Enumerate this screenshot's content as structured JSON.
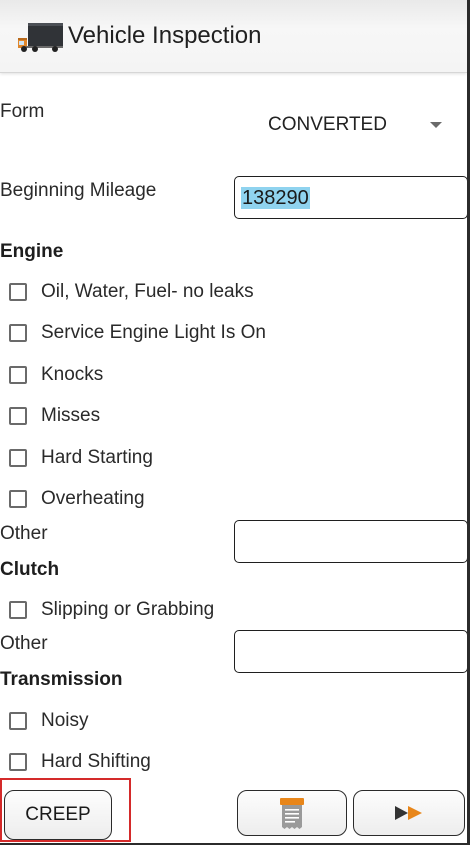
{
  "app": {
    "title": "Vehicle Inspection",
    "icon": "truck-icon"
  },
  "form": {
    "label": "Form",
    "selected": "CONVERTED"
  },
  "mileage": {
    "label": "Beginning Mileage",
    "value": "138290"
  },
  "sections": {
    "engine": {
      "title": "Engine",
      "items": [
        {
          "label": "Oil, Water, Fuel- no leaks",
          "checked": false
        },
        {
          "label": "Service Engine Light Is On",
          "checked": false
        },
        {
          "label": "Knocks",
          "checked": false
        },
        {
          "label": "Misses",
          "checked": false
        },
        {
          "label": "Hard Starting",
          "checked": false
        },
        {
          "label": "Overheating",
          "checked": false
        }
      ],
      "other_label": "Other",
      "other_value": ""
    },
    "clutch": {
      "title": "Clutch",
      "items": [
        {
          "label": "Slipping or Grabbing",
          "checked": false
        }
      ],
      "other_label": "Other",
      "other_value": ""
    },
    "transmission": {
      "title": "Transmission",
      "items": [
        {
          "label": "Noisy",
          "checked": false
        },
        {
          "label": "Hard Shifting",
          "checked": false
        }
      ]
    }
  },
  "footer": {
    "creep_label": "CREEP",
    "document_icon": "receipt-icon",
    "next_icon": "fast-forward-icon",
    "accent_color": "#e8861a",
    "highlight_color": "#d42a2a"
  }
}
